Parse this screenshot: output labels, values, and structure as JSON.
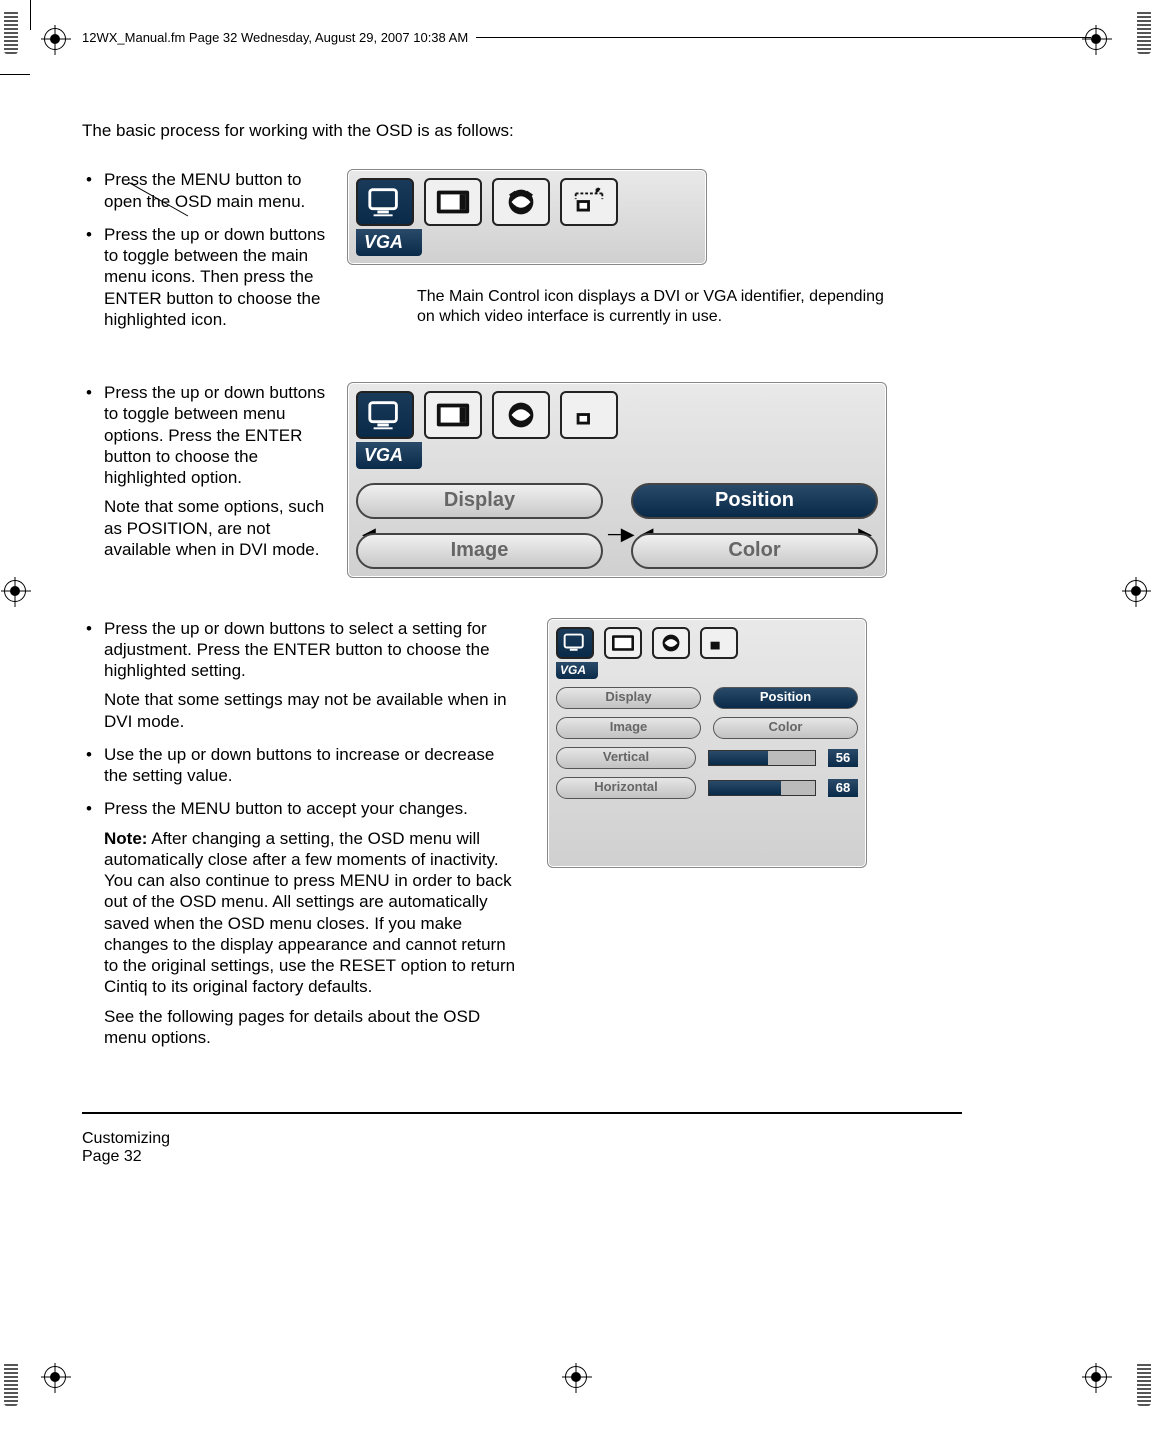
{
  "header": {
    "running_head": "12WX_Manual.fm  Page 32  Wednesday, August 29, 2007  10:38 AM"
  },
  "intro": "The basic process for working with the OSD is as follows:",
  "bullets_a": [
    "Press the MENU button to open the OSD main menu.",
    "Press the up or down buttons to toggle between the main menu icons.  Then press the ENTER button to choose the highlighted icon."
  ],
  "fig1": {
    "vga_label": "VGA",
    "caption": "The Main Control icon displays a DVI or VGA identifier, depending on which video interface is currently in use."
  },
  "bullets_b_main": "Press the up or down buttons to toggle between menu options.  Press the ENTER button to choose the highlighted option.",
  "bullets_b_note": "Note that some options, such as POSITION, are not available when in DVI mode.",
  "fig2": {
    "vga_label": "VGA",
    "display": "Display",
    "position": "Position",
    "image": "Image",
    "color": "Color"
  },
  "sec3": {
    "b1": "Press the up or down buttons to select a setting for adjustment.  Press the ENTER button to choose the highlighted setting.",
    "b1_note": "Note that some settings may not be available when in DVI mode.",
    "b2": "Use the up or down buttons to increase or decrease the setting value.",
    "b3": "Press the MENU button to accept your changes.",
    "note_label": "Note:",
    "note_body": " After changing a setting, the OSD menu will automatically close after a few moments of inactivity.  You can also continue to press MENU in order to back out of the OSD menu.  All settings are automatically saved when the OSD menu closes.  If you make changes to the display appearance and cannot return to the original settings, use the RESET option to return Cintiq to its original factory defaults.",
    "see": "See the following pages for details about the OSD menu options."
  },
  "fig3": {
    "vga_label": "VGA",
    "display": "Display",
    "position": "Position",
    "image": "Image",
    "color": "Color",
    "vertical": "Vertical",
    "horizontal": "Horizontal",
    "v_val": "56",
    "h_val": "68"
  },
  "footer": {
    "section": "Customizing",
    "page_label": "Page  32"
  },
  "chart_data": {
    "type": "table",
    "title": "OSD Position settings",
    "rows": [
      {
        "setting": "Vertical",
        "value": 56
      },
      {
        "setting": "Horizontal",
        "value": 68
      }
    ]
  }
}
